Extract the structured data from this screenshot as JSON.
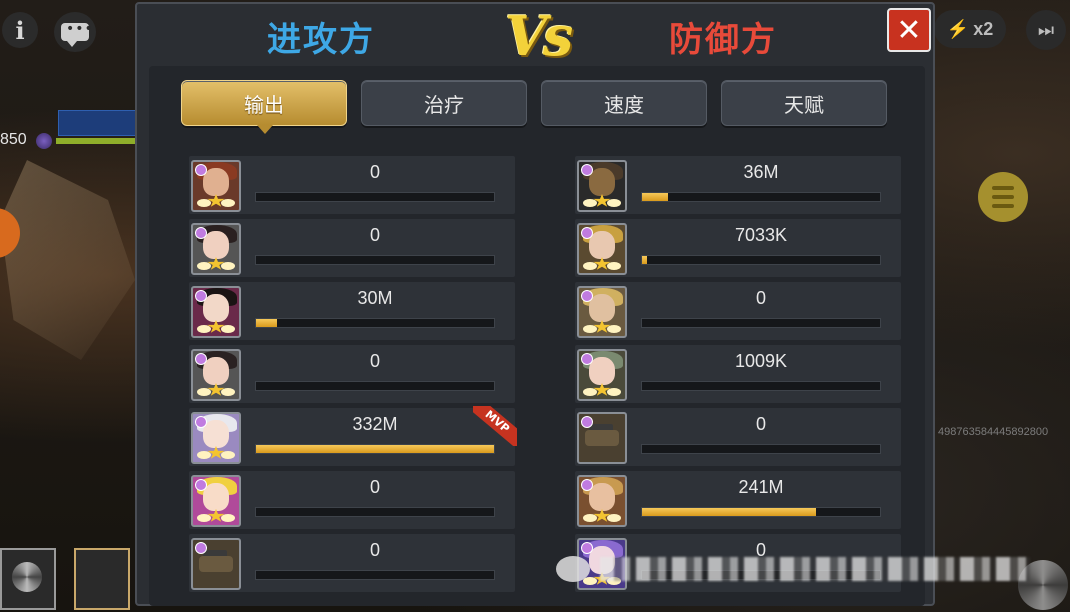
{
  "colors": {
    "attacker": "#3ea8e6",
    "defender": "#e84a3a",
    "accent_gold": "#f3d23a",
    "bar_fill": "#e0a82a",
    "close_red": "#c8321f"
  },
  "background": {
    "hp_value": "850",
    "speed_label": "x2",
    "long_number": "4987635844458928​00"
  },
  "header": {
    "attacker_label": "进攻方",
    "vs_label": "Vs",
    "defender_label": "防御方",
    "close_symbol": "✕"
  },
  "tabs": [
    {
      "label": "输出",
      "active": true
    },
    {
      "label": "治疗",
      "active": false
    },
    {
      "label": "速度",
      "active": false
    },
    {
      "label": "天赋",
      "active": false
    }
  ],
  "attackers": [
    {
      "value": "0",
      "fill": 0,
      "avatar": "hero-red-hair",
      "mvp": false
    },
    {
      "value": "0",
      "fill": 0,
      "avatar": "hero-dark-hair-girl",
      "mvp": false
    },
    {
      "value": "30M",
      "fill": 0.09,
      "avatar": "hero-black-hair-girl",
      "mvp": false
    },
    {
      "value": "0",
      "fill": 0,
      "avatar": "hero-dark-hair-girl-2",
      "mvp": false
    },
    {
      "value": "332M",
      "fill": 1.0,
      "avatar": "hero-white-hair",
      "mvp": true,
      "mvp_label": "MVP"
    },
    {
      "value": "0",
      "fill": 0,
      "avatar": "hero-blonde-girl",
      "mvp": false
    },
    {
      "value": "0",
      "fill": 0,
      "avatar": "vehicle-buggy",
      "mvp": false
    }
  ],
  "defenders": [
    {
      "value": "36M",
      "fill": 0.11,
      "avatar": "hero-armored-mask",
      "mvp": false
    },
    {
      "value": "7033K",
      "fill": 0.02,
      "avatar": "hero-gold-helm",
      "mvp": false
    },
    {
      "value": "0",
      "fill": 0,
      "avatar": "hero-gold-helm-2",
      "mvp": false
    },
    {
      "value": "1009K",
      "fill": 0,
      "avatar": "hero-feather-helm",
      "mvp": false
    },
    {
      "value": "0",
      "fill": 0,
      "avatar": "vehicle-buggy",
      "mvp": false
    },
    {
      "value": "241M",
      "fill": 0.73,
      "avatar": "hero-blonde-man",
      "mvp": false
    },
    {
      "value": "0",
      "fill": 0,
      "avatar": "hero-purple-hair",
      "mvp": false
    }
  ]
}
